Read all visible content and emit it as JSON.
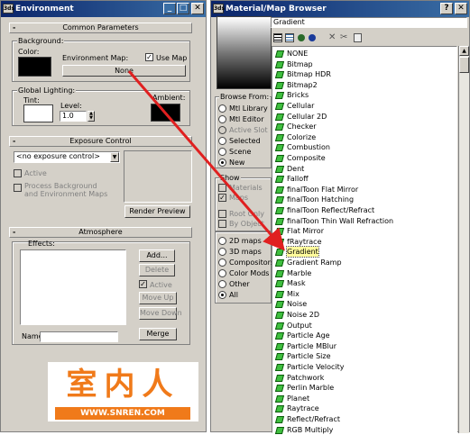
{
  "environment": {
    "title": "Environment",
    "common": {
      "header": "Common Parameters",
      "background_label": "Background:",
      "color_label": "Color:",
      "env_map_label": "Environment Map:",
      "use_map_label": "Use Map",
      "env_map_button": "None",
      "global_lighting_label": "Global Lighting:",
      "tint_label": "Tint:",
      "level_label": "Level:",
      "level_value": "1.0",
      "ambient_label": "Ambient:"
    },
    "exposure": {
      "header": "Exposure Control",
      "dropdown_value": "<no exposure control>",
      "active_label": "Active",
      "process_bg_label": "Process Background",
      "process_bg_label2": "and Environment Maps",
      "render_preview": "Render Preview"
    },
    "atmosphere": {
      "header": "Atmosphere",
      "effects_label": "Effects:",
      "add": "Add...",
      "delete": "Delete",
      "active": "Active",
      "move_up": "Move Up",
      "move_down": "Move Down",
      "name_label": "Name:",
      "merge": "Merge"
    }
  },
  "watermark": {
    "chinese": "室内人",
    "url": "WWW.SNREN.COM"
  },
  "browser": {
    "title": "Material/Map Browser",
    "name_field": "Gradient",
    "browse_from": {
      "label": "Browse From:",
      "options": [
        {
          "label": "Mtl Library",
          "disabled": false,
          "selected": false
        },
        {
          "label": "Mtl Editor",
          "disabled": false,
          "selected": false
        },
        {
          "label": "Active Slot",
          "disabled": true,
          "selected": false
        },
        {
          "label": "Selected",
          "disabled": false,
          "selected": false
        },
        {
          "label": "Scene",
          "disabled": false,
          "selected": false
        },
        {
          "label": "New",
          "disabled": false,
          "selected": true
        }
      ]
    },
    "show": {
      "label": "Show",
      "materials": "Materials",
      "maps": "Maps",
      "root_only": "Root Only",
      "by_object": "By Object"
    },
    "map_types": [
      {
        "label": "2D maps",
        "selected": false
      },
      {
        "label": "3D maps",
        "selected": false
      },
      {
        "label": "Compositors",
        "selected": false
      },
      {
        "label": "Color Mods",
        "selected": false
      },
      {
        "label": "Other",
        "selected": false
      },
      {
        "label": "All",
        "selected": true
      }
    ],
    "maps": [
      "NONE",
      "Bitmap",
      "Bitmap HDR",
      "Bitmap2",
      "Bricks",
      "Cellular",
      "Cellular 2D",
      "Checker",
      "Colorize",
      "Combustion",
      "Composite",
      "Dent",
      "Falloff",
      "finalToon Flat Mirror",
      "finalToon Hatching",
      "finalToon Reflect/Refract",
      "finalToon Thin Wall Refraction",
      "Flat Mirror",
      "fRaytrace",
      "Gradient",
      "Gradient Ramp",
      "Marble",
      "Mask",
      "Mix",
      "Noise",
      "Noise 2D",
      "Output",
      "Particle Age",
      "Particle MBlur",
      "Particle Size",
      "Particle Velocity",
      "Patchwork",
      "Perlin Marble",
      "Planet",
      "Raytrace",
      "Reflect/Refract",
      "RGB Multiply"
    ],
    "selected_map": "Gradient"
  },
  "colors": {
    "title_bar": "#0a246a",
    "annotation_arrow": "#e02020",
    "watermark_orange": "#f07a1a",
    "map_icon": "#3fbf3f"
  }
}
